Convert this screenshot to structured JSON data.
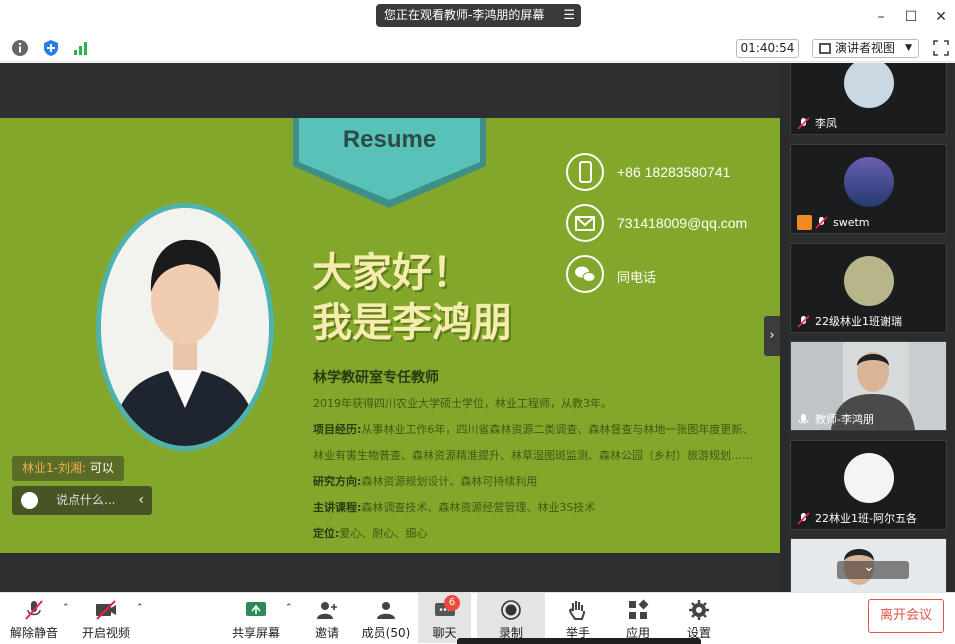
{
  "window": {
    "share_notice": "您正在观看教师-李鸿朋的屏幕",
    "menu_glyph": "☰",
    "minimize": "–",
    "maximize": "☐",
    "close": "✕"
  },
  "topbar": {
    "timer": "01:40:54",
    "view_mode": "演讲者视图",
    "view_caret": "▼"
  },
  "slide": {
    "banner": "Resume",
    "phone": "+86 18283580741",
    "email": "731418009@qq.com",
    "wechat": "同电话",
    "greeting_line1": "大家好！",
    "greeting_line2": "我是李鸿朋",
    "job_title": "林学教研室专任教师",
    "line1": "2019年获得四川农业大学硕士学位，林业工程师，从教3年。",
    "line2_key": "项目经历:",
    "line2_val": "从事林业工作6年，四川省森林资源二类调查、森林督查与林地一张图年度更新、",
    "line3": "林业有害生物普查、森林资源精准提升、林草湿图斑监测、森林公园（乡村）旅游规划……",
    "line4_key": "研究方向:",
    "line4_val": "森林资源规划设计、森林可持续利用",
    "line5_key": "主讲课程:",
    "line5_val": "森林调查技术、森林资源经营管理、林业3S技术",
    "line6_key": "定位:",
    "line6_val": "爱心、耐心、细心"
  },
  "chat": {
    "last_sender": "林业1-刘湘:",
    "last_message": " 可以",
    "input_placeholder": "说点什么...",
    "collapse_glyph": "‹"
  },
  "panel": {
    "toggle_glyph": "›",
    "participants": [
      {
        "name": "李凤"
      },
      {
        "name": "swetm"
      },
      {
        "name": "22级林业1班谢瑞"
      },
      {
        "name": "教师-李鸿朋"
      },
      {
        "name": "22林业1班-阿尔五各"
      }
    ],
    "more_glyph": "⌄"
  },
  "bottombar": {
    "unmute": "解除静音",
    "start_video": "开启视频",
    "share_screen": "共享屏幕",
    "invite": "邀请",
    "members": "成员(50)",
    "chat": "聊天",
    "chat_badge": "6",
    "record": "录制",
    "raise_hand": "举手",
    "apps": "应用",
    "settings": "设置",
    "leave": "离开会议",
    "caret": "⌃"
  },
  "colors": {
    "slide_green": "#82a72b",
    "banner_teal": "#4fb3ad",
    "leave_red": "#e3554b",
    "badge_red": "#ec4a3d"
  }
}
